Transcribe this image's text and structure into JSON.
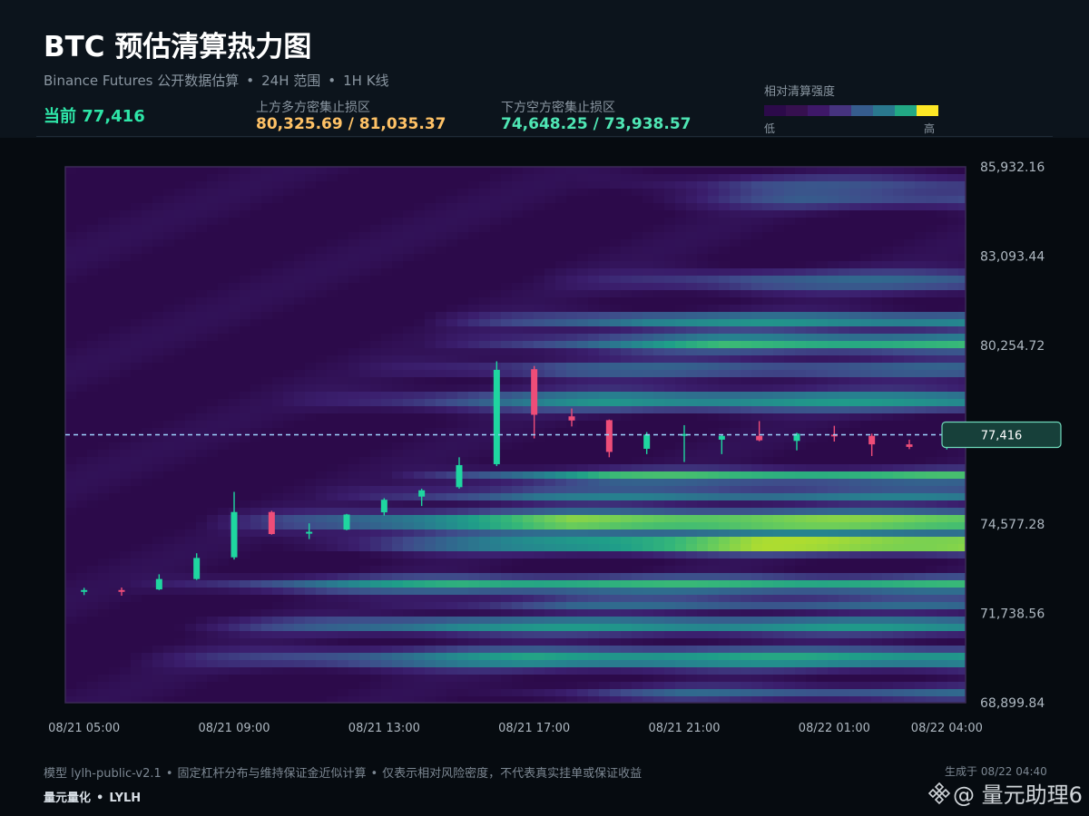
{
  "header": {
    "title": "BTC 预估清算热力图",
    "subtitle_parts": [
      "Binance Futures 公开数据估算",
      "24H 范围",
      "1H K线"
    ],
    "subtitle_separator": "•",
    "current_label": "当前 77,416",
    "upper_zone_label": "上方多方密集止损区",
    "upper_zone_value": "80,325.69 / 81,035.37",
    "lower_zone_label": "下方空方密集止损区",
    "lower_zone_value": "74,648.25 / 73,938.57",
    "legend": {
      "title": "相对清算强度",
      "low": "低",
      "high": "高",
      "colors": [
        "#2c0a4a",
        "#36104f",
        "#3e1868",
        "#46337e",
        "#365c8d",
        "#2a788e",
        "#22a884",
        "#fde725"
      ]
    }
  },
  "colors": {
    "up_candle": "#1fd6a0",
    "down_candle": "#ee4d78",
    "current_line": "#9fd3ff",
    "heat_scale": [
      "#2c0a4a",
      "#3b1f6e",
      "#3f4a8a",
      "#31688e",
      "#26838f",
      "#1f9e89",
      "#35b779",
      "#6ece58",
      "#b5de2b",
      "#fde725"
    ]
  },
  "chart_data": {
    "type": "heatmap",
    "title": "BTC 预估清算热力图",
    "y_ticks": [
      "85,932.16",
      "83,093.44",
      "80,254.72",
      "77,416",
      "74,577.28",
      "71,738.56",
      "68,899.84"
    ],
    "y_tick_values": [
      85932.16,
      83093.44,
      80254.72,
      77416,
      74577.28,
      71738.56,
      68899.84
    ],
    "ylim": [
      68899.84,
      85932.16
    ],
    "x_ticks": [
      "08/21 05:00",
      "08/21 09:00",
      "08/21 13:00",
      "08/21 17:00",
      "08/21 21:00",
      "08/22 01:00",
      "08/22 04:00"
    ],
    "x_tick_hours": [
      0,
      4,
      8,
      12,
      16,
      20,
      23
    ],
    "x_range_hours": [
      -0.5,
      23.5
    ],
    "current_price": 77416,
    "current_price_label": "77,416",
    "grid": false,
    "heat_bands": [
      {
        "price": 73938.57,
        "start": 5,
        "peak": 1.0,
        "ramp": 13,
        "width": 260
      },
      {
        "price": 74648.25,
        "start": 3,
        "peak": 0.86,
        "ramp": 10,
        "width": 320
      },
      {
        "price": 72650,
        "start": 1,
        "peak": 0.64,
        "ramp": 9,
        "width": 240
      },
      {
        "price": 72050,
        "start": 7,
        "peak": 0.34,
        "ramp": 6,
        "width": 200
      },
      {
        "price": 71350,
        "start": 2,
        "peak": 0.52,
        "ramp": 8,
        "width": 260
      },
      {
        "price": 70300,
        "start": 1,
        "peak": 0.58,
        "ramp": 11,
        "width": 320
      },
      {
        "price": 69200,
        "start": 10,
        "peak": 0.3,
        "ramp": 6,
        "width": 240
      },
      {
        "price": 76100,
        "start": 8,
        "peak": 0.68,
        "ramp": 6,
        "width": 200
      },
      {
        "price": 75500,
        "start": 6,
        "peak": 0.42,
        "ramp": 6,
        "width": 220
      },
      {
        "price": 80325.69,
        "start": 9,
        "peak": 0.66,
        "ramp": 8,
        "width": 260
      },
      {
        "price": 81035.37,
        "start": 9,
        "peak": 0.5,
        "ramp": 6,
        "width": 250
      },
      {
        "price": 78500,
        "start": 5,
        "peak": 0.52,
        "ramp": 9,
        "width": 320
      },
      {
        "price": 79500,
        "start": 7,
        "peak": 0.3,
        "ramp": 6,
        "width": 300
      },
      {
        "price": 82300,
        "start": 12,
        "peak": 0.3,
        "ramp": 6,
        "width": 350
      },
      {
        "price": 84900,
        "start": 14,
        "peak": 0.24,
        "ramp": 5,
        "width": 320
      },
      {
        "price": 85400,
        "start": 13,
        "peak": 0.2,
        "ramp": 5,
        "width": 280
      }
    ],
    "candles": [
      {
        "t": 0,
        "o": 72450,
        "h": 72550,
        "l": 72320,
        "c": 72480
      },
      {
        "t": 1,
        "o": 72480,
        "h": 72560,
        "l": 72300,
        "c": 72430
      },
      {
        "t": 2,
        "o": 72500,
        "h": 72980,
        "l": 72480,
        "c": 72830
      },
      {
        "t": 3,
        "o": 72830,
        "h": 73650,
        "l": 72800,
        "c": 73500
      },
      {
        "t": 4,
        "o": 73520,
        "h": 75600,
        "l": 73450,
        "c": 74960
      },
      {
        "t": 5,
        "o": 74960,
        "h": 75000,
        "l": 74240,
        "c": 74260
      },
      {
        "t": 6,
        "o": 74290,
        "h": 74600,
        "l": 74100,
        "c": 74330
      },
      {
        "t": 7,
        "o": 74400,
        "h": 74900,
        "l": 74380,
        "c": 74880
      },
      {
        "t": 8,
        "o": 74950,
        "h": 75400,
        "l": 74850,
        "c": 75350
      },
      {
        "t": 9,
        "o": 75450,
        "h": 75700,
        "l": 75150,
        "c": 75650
      },
      {
        "t": 10,
        "o": 75750,
        "h": 76700,
        "l": 75700,
        "c": 76450
      },
      {
        "t": 11,
        "o": 76480,
        "h": 79750,
        "l": 76420,
        "c": 79480
      },
      {
        "t": 12,
        "o": 79500,
        "h": 79600,
        "l": 77300,
        "c": 78050
      },
      {
        "t": 13,
        "o": 78000,
        "h": 78250,
        "l": 77680,
        "c": 77870
      },
      {
        "t": 14,
        "o": 77880,
        "h": 77900,
        "l": 76700,
        "c": 76870
      },
      {
        "t": 15,
        "o": 76970,
        "h": 77500,
        "l": 76800,
        "c": 77420
      },
      {
        "t": 16,
        "o": 77420,
        "h": 77720,
        "l": 76550,
        "c": 77440
      },
      {
        "t": 17,
        "o": 77260,
        "h": 77400,
        "l": 76800,
        "c": 77380
      },
      {
        "t": 18,
        "o": 77380,
        "h": 77850,
        "l": 77210,
        "c": 77240
      },
      {
        "t": 19,
        "o": 77220,
        "h": 77480,
        "l": 76920,
        "c": 77450
      },
      {
        "t": 20,
        "o": 77420,
        "h": 77700,
        "l": 77200,
        "c": 77370
      },
      {
        "t": 21,
        "o": 77380,
        "h": 77450,
        "l": 76740,
        "c": 77110
      },
      {
        "t": 22,
        "o": 77110,
        "h": 77260,
        "l": 76960,
        "c": 77030
      },
      {
        "t": 23,
        "o": 77030,
        "h": 77440,
        "l": 76950,
        "c": 77416
      }
    ]
  },
  "footer": {
    "note_parts": [
      "模型 lylh-public-v2.1",
      "固定杠杆分布与维持保证金近似计算",
      "仅表示相对风险密度，不代表真实挂单或保证收益"
    ],
    "brand_parts": [
      "量元量化",
      "LYLH"
    ],
    "separator": "•",
    "generated": "生成于 08/22 04:40",
    "watermark": "@ 量元助理6",
    "watermark_logo_icon": "binance-diamond-logo-icon"
  }
}
